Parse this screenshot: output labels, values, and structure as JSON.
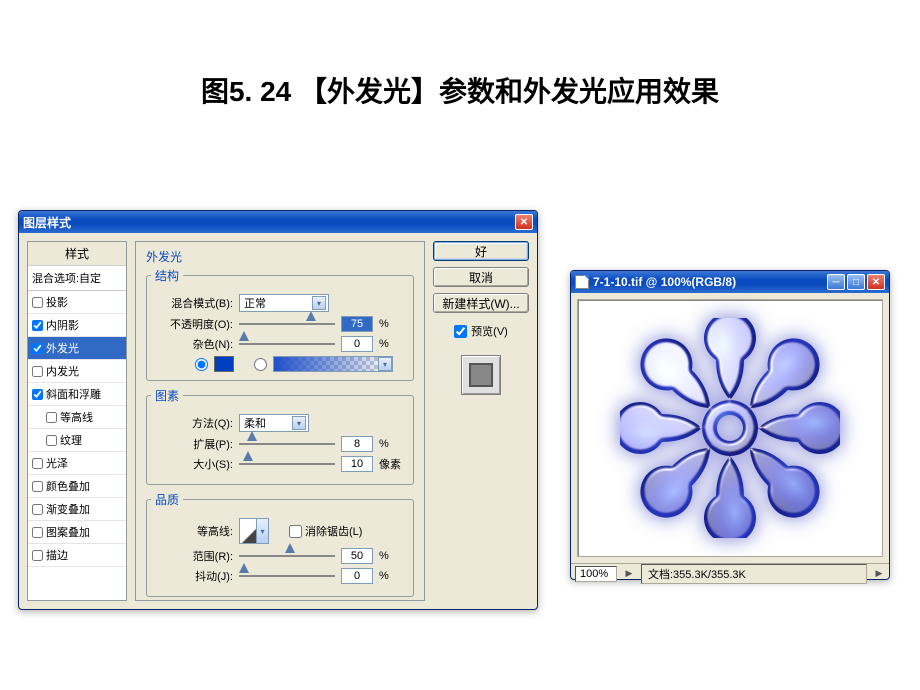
{
  "page": {
    "title": "图5. 24 【外发光】参数和外发光应用效果"
  },
  "dialog": {
    "title": "图层样式",
    "styles_header": "样式",
    "blending_options": "混合选项:自定",
    "styles": [
      {
        "label": "投影",
        "checked": false,
        "indent": false
      },
      {
        "label": "内阴影",
        "checked": true,
        "indent": false
      },
      {
        "label": "外发光",
        "checked": true,
        "indent": false,
        "selected": true
      },
      {
        "label": "内发光",
        "checked": false,
        "indent": false
      },
      {
        "label": "斜面和浮雕",
        "checked": true,
        "indent": false
      },
      {
        "label": "等高线",
        "checked": false,
        "indent": true
      },
      {
        "label": "纹理",
        "checked": false,
        "indent": true
      },
      {
        "label": "光泽",
        "checked": false,
        "indent": false
      },
      {
        "label": "颜色叠加",
        "checked": false,
        "indent": false
      },
      {
        "label": "渐变叠加",
        "checked": false,
        "indent": false
      },
      {
        "label": "图案叠加",
        "checked": false,
        "indent": false
      },
      {
        "label": "描边",
        "checked": false,
        "indent": false
      }
    ],
    "section_title": "外发光",
    "structure": {
      "legend": "结构",
      "blend_mode_label": "混合模式(B):",
      "blend_mode_value": "正常",
      "opacity_label": "不透明度(O):",
      "opacity_value": "75",
      "opacity_unit": "%",
      "noise_label": "杂色(N):",
      "noise_value": "0",
      "noise_unit": "%"
    },
    "elements": {
      "legend": "图素",
      "technique_label": "方法(Q):",
      "technique_value": "柔和",
      "spread_label": "扩展(P):",
      "spread_value": "8",
      "spread_unit": "%",
      "size_label": "大小(S):",
      "size_value": "10",
      "size_unit": "像素"
    },
    "quality": {
      "legend": "品质",
      "contour_label": "等高线:",
      "antialias_label": "消除锯齿(L)",
      "range_label": "范围(R):",
      "range_value": "50",
      "range_unit": "%",
      "jitter_label": "抖动(J):",
      "jitter_value": "0",
      "jitter_unit": "%"
    },
    "buttons": {
      "ok": "好",
      "cancel": "取消",
      "new_style": "新建样式(W)...",
      "preview": "预览(V)"
    }
  },
  "docwin": {
    "title": "7-1-10.tif @ 100%(RGB/8)",
    "zoom": "100%",
    "docinfo": "文档:355.3K/355.3K"
  }
}
